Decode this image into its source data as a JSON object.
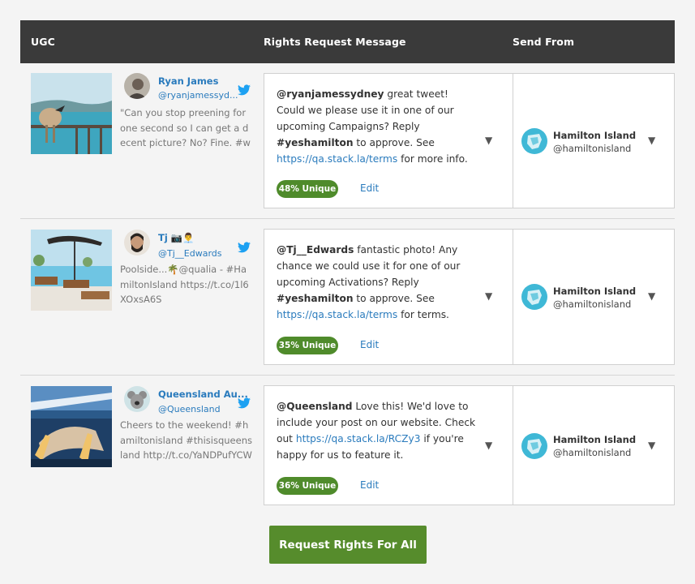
{
  "header": {
    "ugc": "UGC",
    "message": "Rights Request Message",
    "send_from": "Send From"
  },
  "rows": [
    {
      "name": "Ryan James",
      "handle": "@ryanjamessyd...",
      "text": "\"Can you stop preening for one second so I can get a decent picture? No? Fine. #whits...",
      "msg_handle": "@ryanjamessydney",
      "msg_part1": " great tweet! Could we please use it in one of our upcoming Campaigns? Reply ",
      "msg_tag": "#yeshamilton",
      "msg_part2": " to approve. See ",
      "msg_link": "https://qa.stack.la/terms",
      "msg_part3": " for more info.",
      "unique": "48% Unique",
      "edit": "Edit",
      "send_name": "Hamilton Island",
      "send_handle": "@hamiltonisland"
    },
    {
      "name": "Tj 📷👨‍💼",
      "handle": "@Tj__Edwards",
      "text": "Poolside...🌴@qualia - #HamiltonIsland https://t.co/1l6XOxsA6S",
      "msg_handle": "@Tj__Edwards",
      "msg_part1": " fantastic photo! Any chance we could use it for one of our upcoming Activations? Reply ",
      "msg_tag": "#yeshamilton",
      "msg_part2": " to approve. See ",
      "msg_link": "https://qa.stack.la/terms",
      "msg_part3": " for terms.",
      "unique": "35% Unique",
      "edit": "Edit",
      "send_name": "Hamilton Island",
      "send_handle": "@hamiltonisland"
    },
    {
      "name": "Queensland Au...",
      "handle": "@Queensland",
      "text": "Cheers to the weekend! #hamiltonisland #thisisqueensland http://t.co/YaNDPufYCW",
      "msg_handle": "@Queensland",
      "msg_part1": " Love this! We'd love to include your post on our website. Check out ",
      "msg_tag": "",
      "msg_part2": "",
      "msg_link": "https://qa.stack.la/RCZy3",
      "msg_part3": " if you're happy for us to feature it.",
      "unique": "36% Unique",
      "edit": "Edit",
      "send_name": "Hamilton Island",
      "send_handle": "@hamiltonisland"
    }
  ],
  "cta": {
    "label": "Request Rights For All"
  },
  "colors": {
    "header_bg": "#3a3a3a",
    "link": "#2a7bbd",
    "badge": "#4f8b2b",
    "button": "#568c2c"
  }
}
